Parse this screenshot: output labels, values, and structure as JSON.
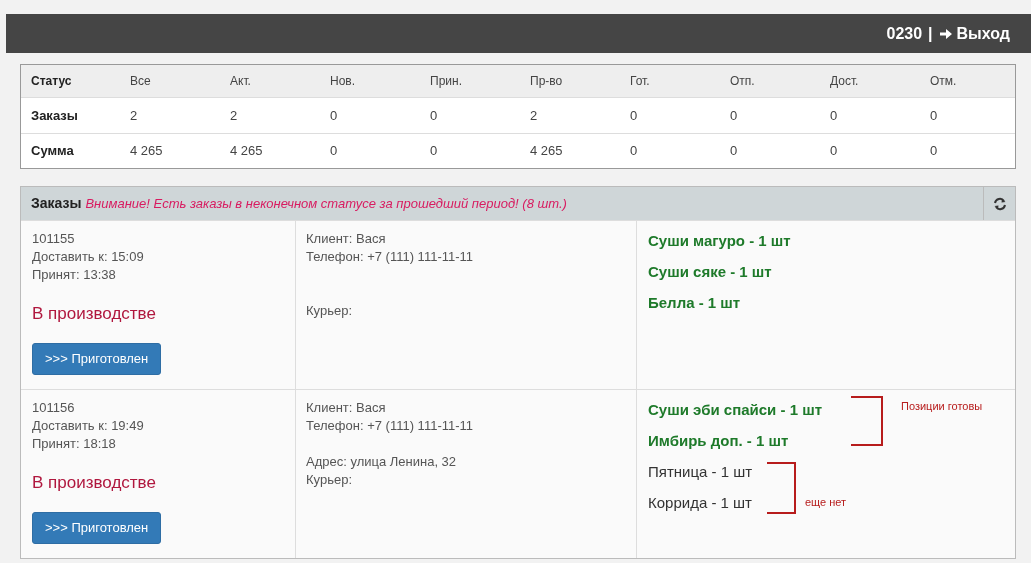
{
  "header": {
    "user": "0230",
    "separator": "|",
    "logout": "Выход"
  },
  "stats": {
    "columns": [
      "Статус",
      "Все",
      "Акт.",
      "Нов.",
      "Прин.",
      "Пр-во",
      "Гот.",
      "Отп.",
      "Дост.",
      "Отм."
    ],
    "rows": [
      [
        "Заказы",
        "2",
        "2",
        "0",
        "0",
        "2",
        "0",
        "0",
        "0",
        "0"
      ],
      [
        "Сумма",
        "4 265",
        "4 265",
        "0",
        "0",
        "4 265",
        "0",
        "0",
        "0",
        "0"
      ]
    ]
  },
  "orders_panel": {
    "title": "Заказы",
    "warning": "Внимание! Есть заказы в неконечном статусе за прошедший период! (8 шт.)",
    "orders": [
      {
        "number": "101155",
        "deliver": "Доставить к: 15:09",
        "accepted": "Принят: 13:38",
        "status": "В производстве",
        "button": ">>> Приготовлен",
        "client": "Клиент: Вася",
        "phone": "Телефон: +7 (111) 111-11-11",
        "courier": "Курьер:",
        "items": [
          {
            "text": "Суши магуро - 1 шт",
            "ready": true
          },
          {
            "text": "Суши сяке - 1 шт",
            "ready": true
          },
          {
            "text": "Белла - 1 шт",
            "ready": true
          }
        ]
      },
      {
        "number": "101156",
        "deliver": "Доставить к: 19:49",
        "accepted": "Принят: 18:18",
        "status": "В производстве",
        "button": ">>> Приготовлен",
        "client": "Клиент: Вася",
        "phone": "Телефон: +7 (111) 111-11-11",
        "address": "Адрес: улица Ленина, 32",
        "courier": "Курьер:",
        "items": [
          {
            "text": "Суши эби спайси - 1 шт",
            "ready": true
          },
          {
            "text": "Имбирь доп. - 1 шт",
            "ready": true
          },
          {
            "text": "Пятница - 1 шт",
            "ready": false
          },
          {
            "text": "Коррида - 1 шт",
            "ready": false
          }
        ],
        "annotations": [
          {
            "text": "Позиции готовы",
            "kind": "ready"
          },
          {
            "text": "еще нет",
            "kind": "pending"
          }
        ]
      }
    ]
  }
}
